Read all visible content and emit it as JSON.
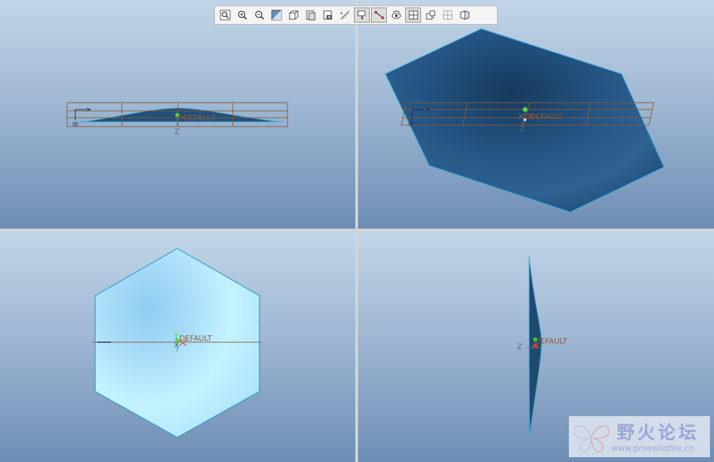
{
  "toolbar": {
    "buttons": [
      {
        "name": "refit-icon",
        "pressed": false
      },
      {
        "name": "zoom-in-icon",
        "pressed": false
      },
      {
        "name": "zoom-out-icon",
        "pressed": false
      },
      {
        "name": "reorient-icon",
        "pressed": false
      },
      {
        "name": "saved-views-icon",
        "pressed": false
      },
      {
        "name": "display-style-icon",
        "pressed": false
      },
      {
        "name": "view-manager-icon",
        "pressed": false
      },
      {
        "name": "datum-planes-icon",
        "pressed": false
      },
      {
        "name": "datum-axes-icon",
        "pressed": true
      },
      {
        "name": "datum-points-icon",
        "pressed": true
      },
      {
        "name": "coordinate-systems-icon",
        "pressed": false
      },
      {
        "name": "multi-viewport-icon",
        "pressed": true
      },
      {
        "name": "spin-center-icon",
        "pressed": false
      },
      {
        "name": "single-viewport-icon",
        "pressed": false
      },
      {
        "name": "view-section-icon",
        "pressed": false
      }
    ]
  },
  "viewports": [
    {
      "id": "top-left",
      "csys_label": "DEFAULT",
      "axis_z": "Z"
    },
    {
      "id": "top-right",
      "csys_label": "DEFAULT",
      "axis_z": "Z",
      "axis_x": "X"
    },
    {
      "id": "bottom-left",
      "csys_label": "DEFAULT",
      "axis_y": "Y",
      "axis_x": "X"
    },
    {
      "id": "bottom-right",
      "csys_label": "DEFAULT",
      "axis_z": "Z"
    }
  ],
  "watermark": {
    "title": "野火论坛",
    "url": "www.proewildfire.cn"
  },
  "colors": {
    "datum_plane": "#8a5a3a",
    "part_dark": "#1f4a70",
    "part_light": "#bfeeff",
    "edge": "#3aa9d8",
    "csys_label": "#8b5a3c"
  }
}
